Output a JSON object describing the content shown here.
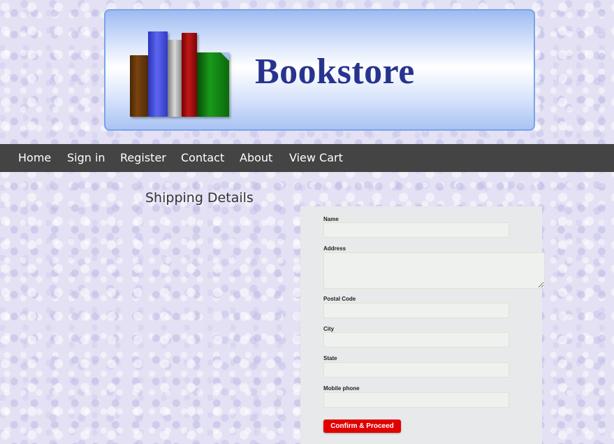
{
  "header": {
    "brand": "Bookstore"
  },
  "nav": {
    "items": [
      "Home",
      "Sign in",
      "Register",
      "Contact",
      "About",
      "View Cart"
    ]
  },
  "page": {
    "title": "Shipping Details"
  },
  "form": {
    "fields": [
      {
        "label": "Name",
        "value": ""
      },
      {
        "label": "Address",
        "value": ""
      },
      {
        "label": "Postal Code",
        "value": ""
      },
      {
        "label": "City",
        "value": ""
      },
      {
        "label": "State",
        "value": ""
      },
      {
        "label": "Mobile phone",
        "value": ""
      }
    ],
    "submit_label": "Confirm & Proceed"
  },
  "colors": {
    "nav_bg": "#444444",
    "brand": "#27348f",
    "button": "#e00000"
  }
}
